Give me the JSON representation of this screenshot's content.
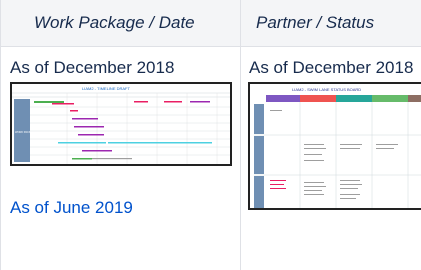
{
  "table": {
    "headers": [
      "Work Package / Date",
      "Partner / Status"
    ],
    "col1": {
      "caption": "As of December 2018",
      "link_text": "As of June 2019",
      "thumb_title": "LIAM2 - TIMELINE DRAFT",
      "thumb_group_label": "WORK PACKAGES"
    },
    "col2": {
      "caption": "As of December 2018",
      "thumb_title": "LIAM2 - SWIM LANE STATUS BOARD"
    }
  },
  "colors": {
    "header_bg": "#f4f5f7",
    "border": "#dfe1e6",
    "link": "#0052cc",
    "timeline_label_bg": "#6f8fb3",
    "bar_green": "#4caf50",
    "bar_pink": "#e91e63",
    "bar_purple": "#9c27b0",
    "bar_cyan": "#4dd0e1",
    "lane_purple": "#7e57c2",
    "lane_red": "#ef5350",
    "lane_teal": "#26a69a",
    "lane_green": "#66bb6a",
    "lane_grey": "#8d6e63"
  }
}
